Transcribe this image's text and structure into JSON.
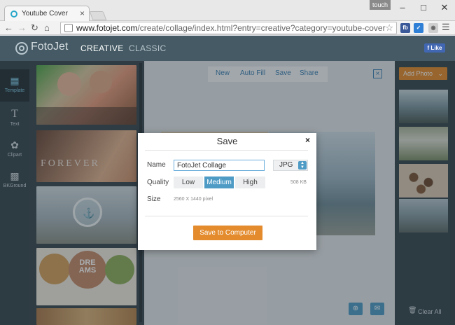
{
  "browser": {
    "tab_title": "Youtube Cover",
    "tab_close": "×",
    "touch_label": "touch",
    "url_host": "www.fotojet.com",
    "url_path": "/create/collage/index.html?entry=creative?category=youtube-cover",
    "ext_fb": "fb",
    "window_minimize": "–",
    "window_maximize": "□",
    "window_close": "✕"
  },
  "app": {
    "logo": "FotoJet",
    "nav": [
      {
        "label": "CREATIVE"
      },
      {
        "label": "CLASSIC"
      }
    ],
    "fb_like": "f Like"
  },
  "leftnav": [
    {
      "label": "Template",
      "icon": "template-icon"
    },
    {
      "label": "Text",
      "icon": "text-icon"
    },
    {
      "label": "Clipart",
      "icon": "clipart-icon"
    },
    {
      "label": "BKGround",
      "icon": "background-icon"
    }
  ],
  "templates": {
    "forever_text": "FOREVER",
    "dream_text": "DRE AMS"
  },
  "canvas_toolbar": [
    {
      "label": "New"
    },
    {
      "label": "Auto Fill"
    },
    {
      "label": "Save"
    },
    {
      "label": "Share"
    }
  ],
  "canvas_close": "×",
  "right": {
    "add_photo": "Add Photo",
    "clear_all": "Clear All"
  },
  "dialog": {
    "title": "Save",
    "close": "×",
    "name_label": "Name",
    "name_value": "FotoJet Collage",
    "format": "JPG",
    "quality_label": "Quality",
    "quality_options": [
      {
        "label": "Low"
      },
      {
        "label": "Medium"
      },
      {
        "label": "High"
      }
    ],
    "quality_selected": "Medium",
    "file_size": "508 KB",
    "size_label": "Size",
    "size_value": "2560 X 1440 pixel",
    "save_button": "Save to Computer"
  },
  "colors": {
    "header": "#455a64",
    "accent_orange": "#e38b2d",
    "accent_blue": "#4e9bc6"
  }
}
